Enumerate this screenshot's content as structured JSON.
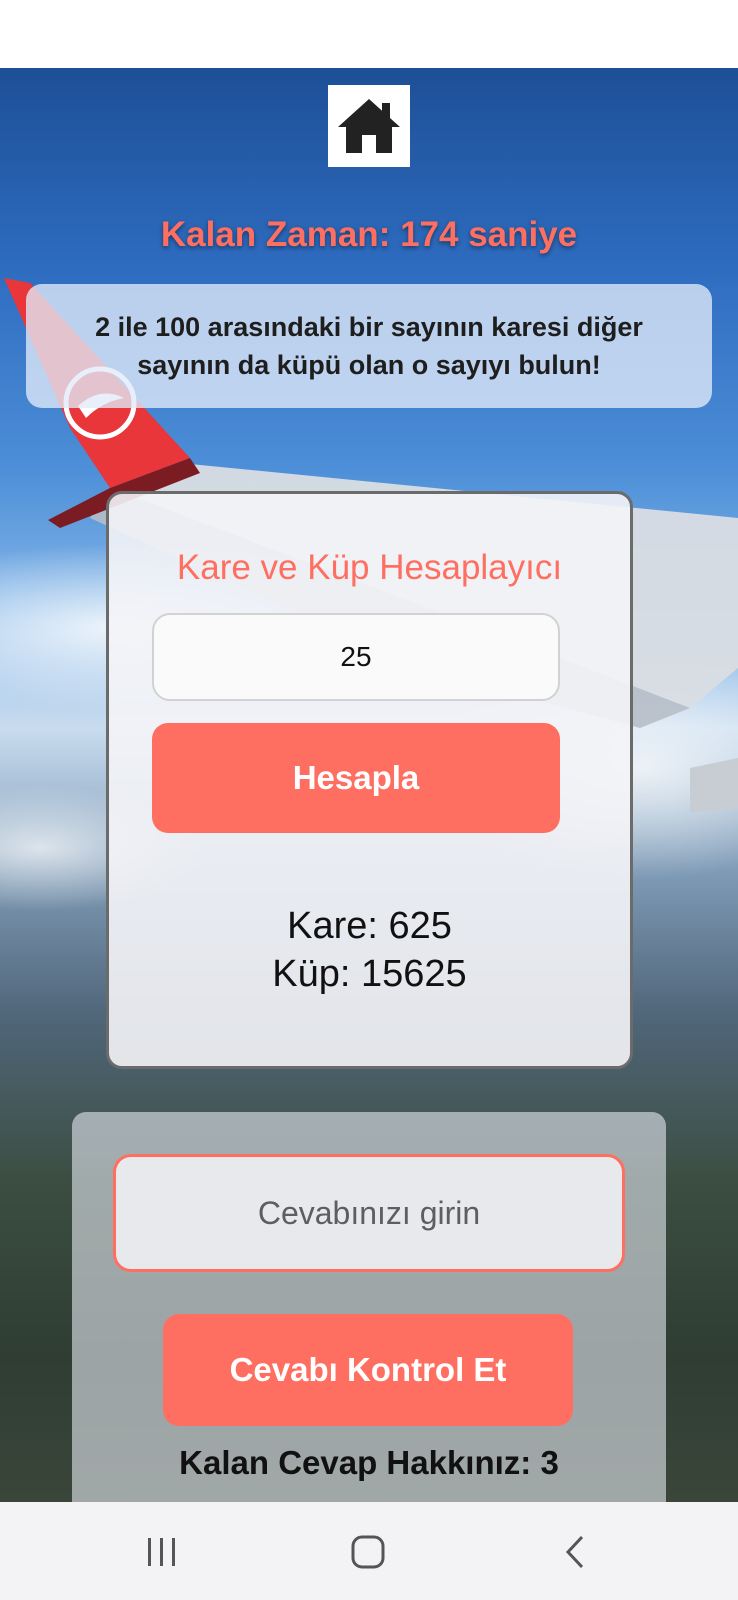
{
  "icons": {
    "home": "home-icon",
    "recents": "recents-icon",
    "home_nav": "home-nav-icon",
    "back": "back-icon"
  },
  "colors": {
    "accent": "#ff6f61",
    "text_dark": "#111111"
  },
  "header": {
    "timer_text": "Kalan Zaman: 174 saniye"
  },
  "question": {
    "text": "2 ile 100 arasındaki bir sayının karesi diğer sayının da küpü olan o sayıyı bulun!"
  },
  "calculator": {
    "title": "Kare ve Küp Hesaplayıcı",
    "input_value": "25",
    "button_label": "Hesapla",
    "square_result": "Kare: 625",
    "cube_result": "Küp: 15625"
  },
  "answer": {
    "placeholder": "Cevabınızı girin",
    "button_label": "Cevabı Kontrol Et",
    "attempts_text": "Kalan Cevap Hakkınız: 3"
  }
}
